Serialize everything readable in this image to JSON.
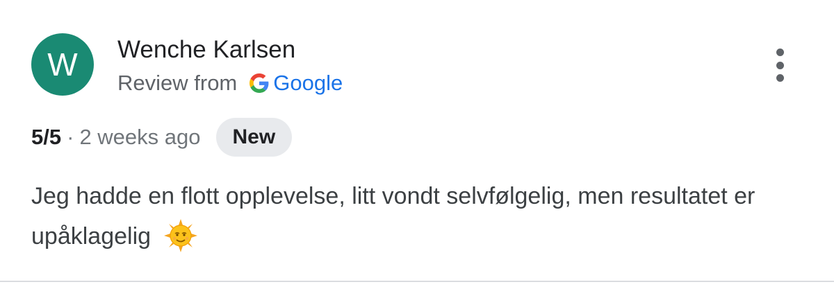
{
  "review": {
    "avatar_letter": "W",
    "author_name": "Wenche Karlsen",
    "source_prefix": "Review from",
    "source_name": "Google",
    "rating": "5/5",
    "separator": "·",
    "time_ago": "2 weeks ago",
    "badge": "New",
    "text": "Jeg hadde en flott opplevelse, litt vondt selvfølgelig, men resultatet er upåklagelig",
    "emoji_icon": "sun-with-face-icon",
    "menu_icon": "more-vert-icon"
  },
  "colors": {
    "avatar_bg": "#1a8a73",
    "google_blue": "#1a73e8",
    "badge_bg": "#e8eaed"
  }
}
